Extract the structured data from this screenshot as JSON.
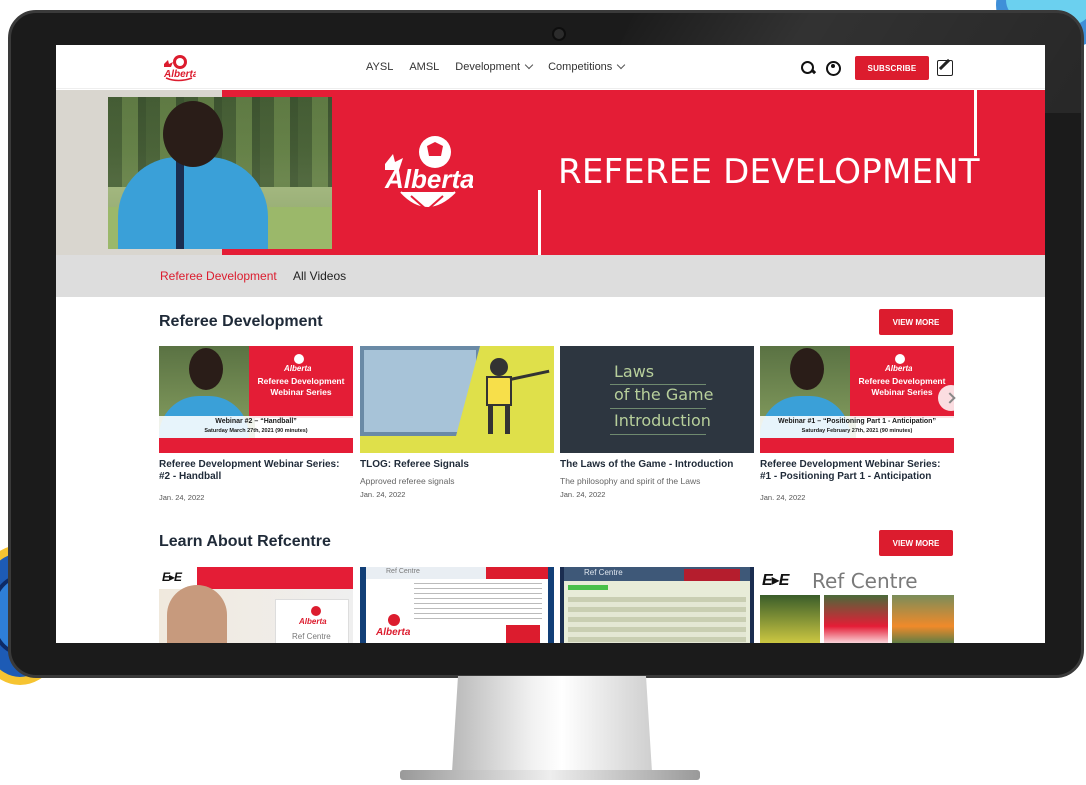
{
  "brand": {
    "logo_text": "Alberta",
    "accent": "#dc1c2e",
    "hero_red": "#e41d36"
  },
  "header": {
    "nav": [
      {
        "label": "AYSL"
      },
      {
        "label": "AMSL"
      },
      {
        "label": "Development",
        "dropdown": true
      },
      {
        "label": "Competitions",
        "dropdown": true
      }
    ],
    "icons": [
      "search-icon",
      "user-icon",
      "edit-icon"
    ],
    "subscribe_label": "SUBSCRIBE"
  },
  "hero": {
    "title": "REFEREE DEVELOPMENT"
  },
  "tabs": [
    {
      "label": "Referee Development",
      "active": true
    },
    {
      "label": "All Videos",
      "active": false
    }
  ],
  "sections": {
    "referee": {
      "title": "Referee Development",
      "view_more": "VIEW MORE",
      "cards": [
        {
          "thumb": {
            "series": "Referee Development Webinar Series",
            "line1": "Webinar #2 – “Handball”",
            "line2": "Saturday March 27th, 2021 (90 minutes)"
          },
          "title_line1": "Referee Development Webinar Series:",
          "title_line2": "#2 - Handball",
          "desc": "",
          "date": "Jan. 24, 2022"
        },
        {
          "title_line1": "TLOG: Referee Signals",
          "title_line2": "",
          "desc": "Approved referee signals",
          "date": "Jan. 24, 2022"
        },
        {
          "thumb": {
            "laws_1": "Laws",
            "laws_2": "of the Game",
            "laws_3": "Introduction"
          },
          "title_line1": "The Laws of the Game - Introduction",
          "title_line2": "",
          "desc": "The philosophy and spirit of the Laws",
          "date": "Jan. 24, 2022"
        },
        {
          "thumb": {
            "series": "Referee Development Webinar Series",
            "line1": "Webinar #1 – “Positioning Part 1 - Anticipation”",
            "line2": "Saturday February 27th, 2021 (90 minutes)"
          },
          "title_line1": "Referee Development Webinar Series:",
          "title_line2": "#1 - Positioning Part 1 - Anticipation",
          "desc": "",
          "date": "Jan. 24, 2022"
        }
      ]
    },
    "refcentre": {
      "title": "Learn About Refcentre",
      "view_more": "VIEW MORE",
      "thumbs": {
        "ee_logo": "E▸E",
        "ref_centre": "Ref Centre",
        "ref_centre_small": "Ref Centre"
      }
    }
  }
}
